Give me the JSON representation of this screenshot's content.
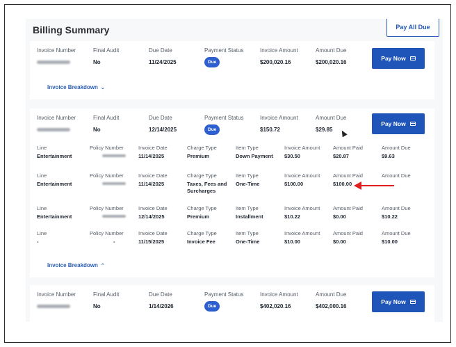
{
  "header": {
    "title": "Billing Summary",
    "pay_all_label": "Pay All Due"
  },
  "columns": {
    "invoice_number": "Invoice Number",
    "final_audit": "Final Audit",
    "due_date": "Due Date",
    "payment_status": "Payment Status",
    "invoice_amount": "Invoice Amount",
    "amount_due": "Amount Due"
  },
  "pay_now_label": "Pay Now",
  "invoices": [
    {
      "final_audit": "No",
      "due_date": "11/24/2025",
      "status": "Due",
      "invoice_amount": "$200,020.16",
      "amount_due": "$200,020.16"
    },
    {
      "final_audit": "No",
      "due_date": "12/14/2025",
      "status": "Due",
      "invoice_amount": "$150.72",
      "amount_due": "$29.85"
    },
    {
      "final_audit": "No",
      "due_date": "1/14/2026",
      "status": "Due",
      "invoice_amount": "$402,020.16",
      "amount_due": "$402,000.16"
    }
  ],
  "breakdown_label": "Invoice Breakdown",
  "detail_columns": {
    "line": "Line",
    "policy_number": "Policy Number",
    "invoice_date": "Invoice Date",
    "charge_type": "Charge Type",
    "item_type": "Item Type",
    "invoice_amount": "Invoice Amount",
    "amount_paid": "Amount Paid",
    "amount_due": "Amount Due"
  },
  "detail_rows": [
    {
      "line": "Entertainment",
      "invoice_date": "11/14/2025",
      "charge_type": "Premium",
      "item_type": "Down Payment",
      "invoice_amount": "$30.50",
      "amount_paid": "$20.87",
      "amount_due": "$9.63"
    },
    {
      "line": "Entertainment",
      "invoice_date": "11/14/2025",
      "charge_type": "Taxes, Fees and Surcharges",
      "item_type": "One-Time",
      "invoice_amount": "$100.00",
      "amount_paid": "$100.00",
      "amount_due": ""
    },
    {
      "line": "Entertainment",
      "invoice_date": "12/14/2025",
      "charge_type": "Premium",
      "item_type": "Installment",
      "invoice_amount": "$10.22",
      "amount_paid": "$0.00",
      "amount_due": "$10.22"
    },
    {
      "line": "-",
      "policy_number": "-",
      "invoice_date": "11/15/2025",
      "charge_type": "Invoice Fee",
      "item_type": "One-Time",
      "invoice_amount": "$10.00",
      "amount_paid": "$0.00",
      "amount_due": "$10.00"
    }
  ],
  "colors": {
    "accent": "#1f55b8",
    "annotation_arrow": "#e02020"
  },
  "icons": [
    "credit-card-icon",
    "chevron-down-icon",
    "chevron-up-icon",
    "mouse-cursor-icon",
    "red-arrow-annotation"
  ]
}
